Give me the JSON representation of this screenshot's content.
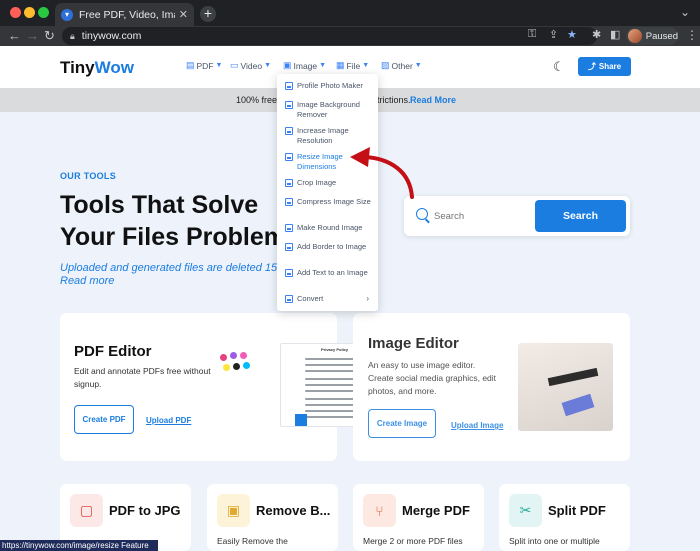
{
  "browser": {
    "tab_title": "Free PDF, Video, Image & Other",
    "url": "tinywow.com",
    "profile_status": "Paused"
  },
  "header": {
    "logo_tiny": "Tiny",
    "logo_wow": "Wow",
    "nav": [
      {
        "label": "PDF",
        "icon": "pdf-icon"
      },
      {
        "label": "Video",
        "icon": "video-icon"
      },
      {
        "label": "Image",
        "icon": "image-icon"
      },
      {
        "label": "File",
        "icon": "file-icon"
      },
      {
        "label": "Other",
        "icon": "other-icon"
      }
    ],
    "share_label": "Share"
  },
  "banner": {
    "text_a": "100% free.",
    "text_b": "trictions.",
    "link": "Read More"
  },
  "hero": {
    "eyebrow": "OUR TOOLS",
    "line1": "Tools That Solve",
    "line2": "Your Files Problem",
    "sub_line1": "Uploaded and generated files are deleted 15",
    "sub_line2": "Read more"
  },
  "search": {
    "placeholder": "Search",
    "button_label": "Search"
  },
  "dropdown": {
    "items": [
      {
        "label": "Profile Photo Maker",
        "active": false
      },
      {
        "label": "Image Background Remover",
        "active": false
      },
      {
        "label": "Increase Image Resolution",
        "active": false
      },
      {
        "label": "Resize Image Dimensions",
        "active": true
      },
      {
        "label": "Crop Image",
        "active": false
      },
      {
        "label": "Compress Image Size",
        "active": false
      },
      {
        "label": "Make Round Image",
        "active": false
      },
      {
        "label": "Add Border to Image",
        "active": false
      },
      {
        "label": "Add Text to an Image",
        "active": false
      },
      {
        "label": "Convert",
        "active": false
      }
    ]
  },
  "pdf_editor": {
    "title": "PDF Editor",
    "desc": "Edit and annotate PDFs free without signup.",
    "create_label": "Create PDF",
    "upload_label": "Upload PDF",
    "preview_heading": "Privacy Policy"
  },
  "image_editor": {
    "title": "Image Editor",
    "desc": "An easy to use image editor. Create social media graphics, edit photos, and more.",
    "create_label": "Create Image",
    "upload_label": "Upload Image"
  },
  "tools": [
    {
      "title": "PDF to JPG",
      "desc": "",
      "icon": "pdf-file-icon",
      "color": "#fde8e8",
      "icolor": "#e0483e"
    },
    {
      "title": "Remove B...",
      "desc": "Easily Remove the",
      "icon": "image-remove-icon",
      "color": "#fdf3d8",
      "icolor": "#e0a82e"
    },
    {
      "title": "Merge PDF",
      "desc": "Merge 2 or more PDF files",
      "icon": "merge-icon",
      "color": "#fde9e2",
      "icolor": "#e0663e"
    },
    {
      "title": "Split PDF",
      "desc": "Split into one or multiple",
      "icon": "scissors-icon",
      "color": "#e2f5f4",
      "icolor": "#2aa89a"
    }
  ],
  "status_bar": {
    "url_text": "https://tinywow.com/image/resize",
    "feature_text": "Feature"
  }
}
